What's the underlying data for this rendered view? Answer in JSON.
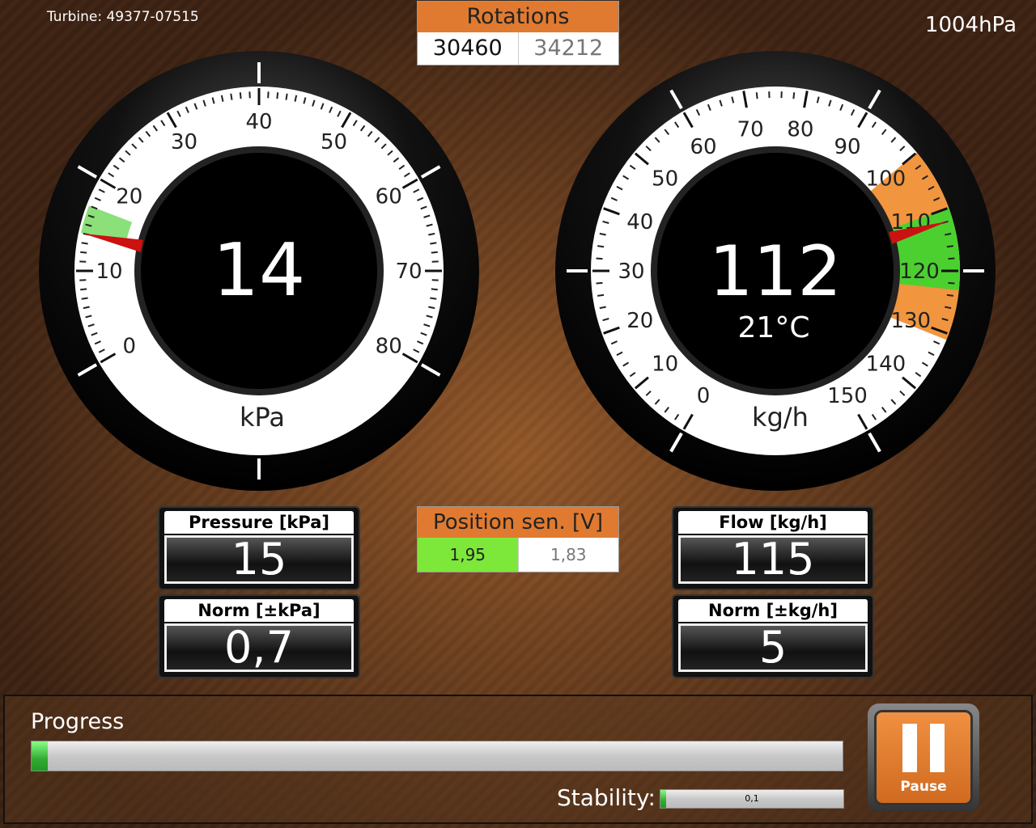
{
  "header": {
    "turbine": "Turbine: 49377-07515",
    "barometer": "1004hPa"
  },
  "rotations": {
    "title": "Rotations",
    "value": "30460",
    "reference": "34212"
  },
  "position_sensor": {
    "title": "Position sen. [V]",
    "value": "1,95",
    "reference": "1,83",
    "value_color": "#7de83a"
  },
  "gauges": [
    {
      "id": "pressure",
      "unit": "kPa",
      "value": "14",
      "min": 0,
      "max": 80,
      "major_step": 10,
      "needle": 14,
      "green_band": [
        14,
        17
      ],
      "orange_band": null
    },
    {
      "id": "flow",
      "unit": "kg/h",
      "value": "112",
      "sub": "21°C",
      "min": 0,
      "max": 150,
      "major_step": 10,
      "needle": 112,
      "green_band": [
        110,
        123
      ],
      "orange_band": [
        100,
        131
      ]
    }
  ],
  "panels": {
    "pressure": {
      "title": "Pressure [kPa]",
      "value": "15"
    },
    "pressure_norm": {
      "title": "Norm [±kPa]",
      "value": "0,7"
    },
    "flow": {
      "title": "Flow [kg/h]",
      "value": "115"
    },
    "flow_norm": {
      "title": "Norm [±kg/h]",
      "value": "5"
    }
  },
  "progress": {
    "label": "Progress",
    "percent": 2
  },
  "stability": {
    "label": "Stability:",
    "value": "0,1",
    "percent": 3
  },
  "pause_button": {
    "label": "Pause"
  },
  "colors": {
    "accent": "#e07a30",
    "ok": "#4cd030",
    "alarm": "#cc1111"
  }
}
